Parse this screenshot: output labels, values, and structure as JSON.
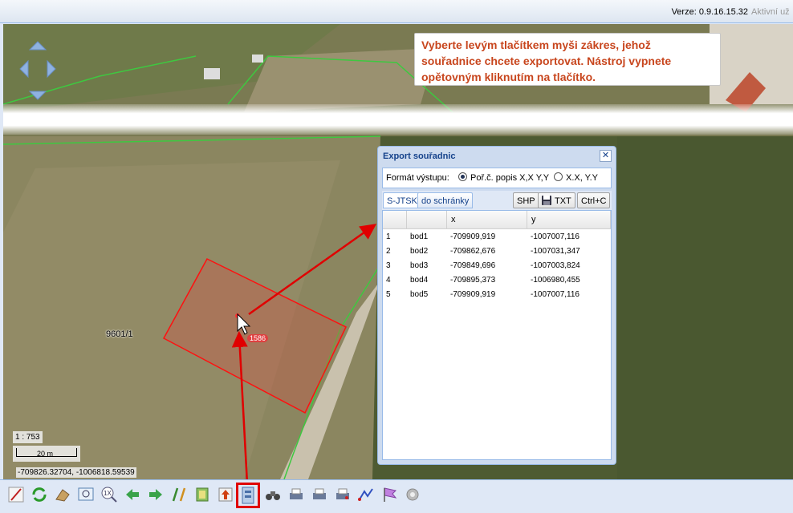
{
  "header": {
    "version": "Verze: 0.9.16.15.32",
    "user": "Aktivní už"
  },
  "tip": {
    "text": "Vyberte levým tlačítkem myši zákres, jehož souřadnice chcete exportovat. Nástroj vypnete opětovným kliknutím na tlačítko."
  },
  "map": {
    "parcel_label": "9601/1",
    "point_label": "1586",
    "scale_text": "1 : 753",
    "scale_bar_label": "20 m",
    "coords": "-709826.32704, -1006818.59539"
  },
  "dialog": {
    "title": "Export souřadnic",
    "format_label": "Formát výstupu:",
    "format_option_1": "Poř.č. popis X,X Y,Y",
    "format_option_2": "X.X, Y.Y",
    "tab_sjtsk": "S-JTSK",
    "tab_clipboard": "do schránky",
    "btn_shp": "SHP",
    "btn_txt": "TXT",
    "btn_copy": "Ctrl+C",
    "columns": [
      "",
      "",
      "x",
      "y"
    ],
    "rows": [
      {
        "n": "1",
        "name": "bod1",
        "x": "-709909,919",
        "y": "-1007007,116"
      },
      {
        "n": "2",
        "name": "bod2",
        "x": "-709862,676",
        "y": "-1007031,347"
      },
      {
        "n": "3",
        "name": "bod3",
        "x": "-709849,696",
        "y": "-1007003,824"
      },
      {
        "n": "4",
        "name": "bod4",
        "x": "-709895,373",
        "y": "-1006980,455"
      },
      {
        "n": "5",
        "name": "bod5",
        "x": "-709909,919",
        "y": "-1007007,116"
      }
    ]
  },
  "toolbar": {
    "icons": [
      "draw-icon",
      "refresh-icon",
      "clear-icon",
      "zoom-window-icon",
      "zoom-1x-icon",
      "back-icon",
      "forward-icon",
      "measure-icon",
      "layers-icon",
      "import-icon",
      "export-coords-icon",
      "binoculars-icon",
      "print-icon",
      "print-area-icon",
      "print-map-icon",
      "route-icon",
      "flag-icon",
      "settings-icon"
    ]
  }
}
